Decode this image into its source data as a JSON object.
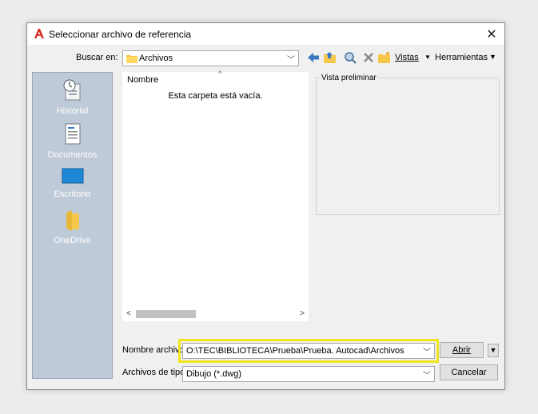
{
  "window": {
    "title": "Seleccionar archivo de referencia",
    "close_glyph": "✕"
  },
  "lookin": {
    "label": "Buscar en:",
    "value": "Archivos"
  },
  "toolbar": {
    "views_label": "Vistas",
    "tools_label": "Herramientas"
  },
  "places": [
    {
      "label": "Historial",
      "icon": "history-icon"
    },
    {
      "label": "Documentos",
      "icon": "documents-icon"
    },
    {
      "label": "Escritorio",
      "icon": "desktop-icon"
    },
    {
      "label": "OneDrive",
      "icon": "onedrive-icon"
    }
  ],
  "filelist": {
    "column": "Nombre",
    "empty_text": "Esta carpeta está vacía."
  },
  "preview": {
    "label": "Vista preliminar"
  },
  "filename": {
    "label": "Nombre archivo:",
    "value": "O:\\TEC\\BIBLIOTECA\\Prueba\\Prueba. Autocad\\Archivos"
  },
  "filetype": {
    "label": "Archivos de tipo:",
    "value": "Dibujo (*.dwg)"
  },
  "buttons": {
    "open": "Abrir",
    "cancel": "Cancelar"
  },
  "colors": {
    "highlight": "#f1e51c",
    "places_bg": "#bfcad8",
    "app_red": "#d9261c"
  }
}
